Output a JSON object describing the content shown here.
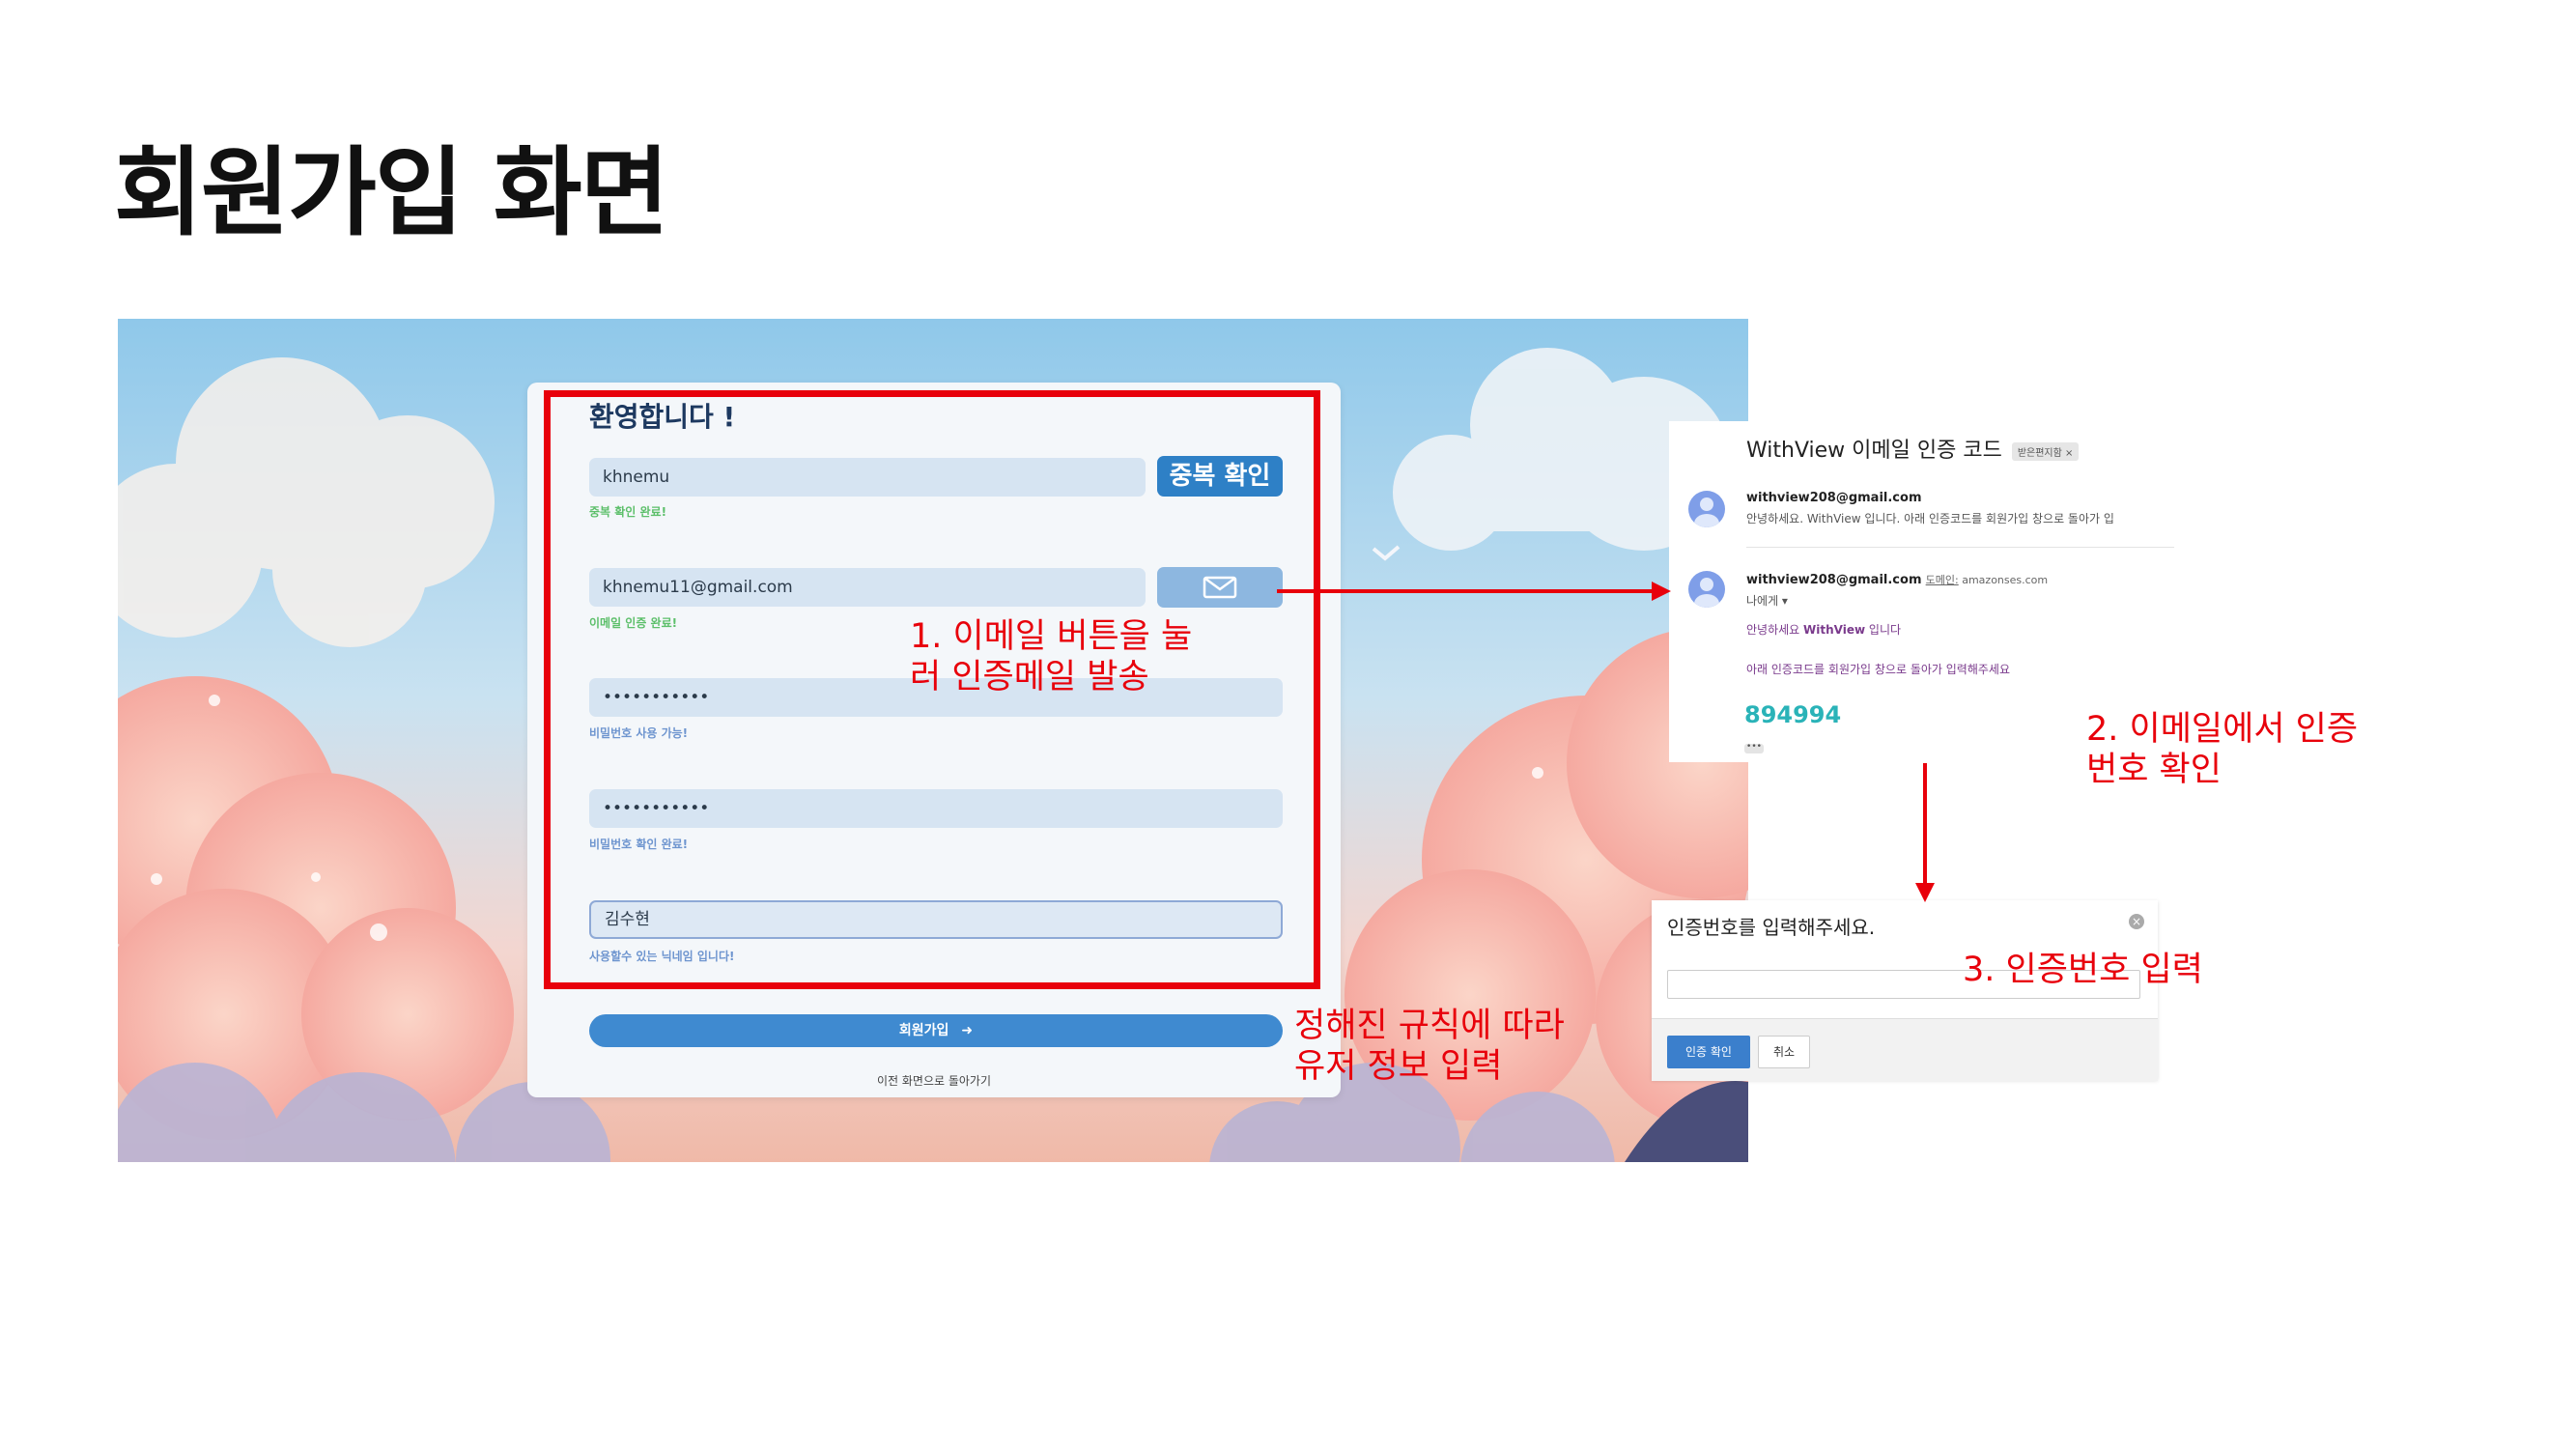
{
  "slide": {
    "title": "회원가입 화면"
  },
  "signup": {
    "heading": "환영합니다 !",
    "username_value": "khnemu",
    "duplicate_check_label": "중복 확인",
    "username_hint": "중복 확인 완료!",
    "email_value": "khnemu11@gmail.com",
    "email_button_icon": "envelope-icon",
    "email_hint": "이메일 인증 완료!",
    "password_value": "•••••••••••",
    "password_hint": "비밀번호 사용 가능!",
    "password_confirm_value": "•••••••••••",
    "password_confirm_hint": "비밀번호 확인 완료!",
    "nickname_value": "김수현",
    "nickname_hint": "사용할수 있는 닉네임 입니다!",
    "signup_button_label": "회원가입",
    "signup_button_icon": "sign-in-icon",
    "back_link": "이전 화면으로 돌아가기"
  },
  "email_view": {
    "subject": "WithView 이메일 인증 코드",
    "folder_tag": "받은편지함 ×",
    "msg1_sender": "withview208@gmail.com",
    "msg1_preview": "안녕하세요. WithView 입니다. 아래 인증코드를 회원가입 창으로 돌아가 입",
    "msg2_sender": "withview208@gmail.com",
    "msg2_via_label": "도메인:",
    "msg2_via_domain": "amazonses.com",
    "msg2_to": "나에게 ▾",
    "greeting_prefix": "안녕하세요",
    "greeting_brand": "WithView",
    "greeting_suffix": "입니다",
    "instruction": "아래 인증코드를 회원가입 창으로 돌아가 입력해주세요",
    "code": "894994",
    "more": "•••"
  },
  "dialog": {
    "title": "인증번호를 입력해주세요.",
    "input_value": "",
    "confirm_label": "인증 확인",
    "cancel_label": "취소"
  },
  "annotations": {
    "step1": "1. 이메일 버튼을 눌\n러 인증메일 발송",
    "step2": "2. 이메일에서 인증\n번호 확인",
    "step3": "3. 인증번호 입력",
    "rules": "정해진 규칙에 따라\n유저 정보 입력"
  },
  "colors": {
    "annotation_red": "#e8000b",
    "primary_blue": "#2e80c6",
    "hint_green": "#5cbf6a",
    "hint_blue": "#6e95cf",
    "code_teal": "#2ab3b8"
  }
}
